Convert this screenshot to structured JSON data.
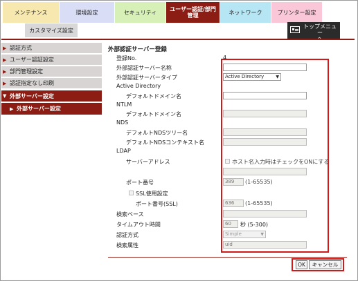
{
  "tabs": {
    "maintenance": "メンテナンス",
    "environment": "環境設定",
    "security": "セキュリティ",
    "user_auth_line1": "ユーザー認証/部門",
    "user_auth_line2": "管理",
    "network": "ネットワーク",
    "printer": "プリンター設定",
    "customize": "カスタマイズ設定"
  },
  "top_menu": {
    "line1": "トップメニュー",
    "line2": "へ",
    "icon": "menu-icon"
  },
  "sidebar": {
    "items": [
      {
        "label": "認証方式"
      },
      {
        "label": "ユーザー認証設定"
      },
      {
        "label": "部門管理設定"
      },
      {
        "label": "認証指定なし印刷"
      },
      {
        "label": "外部サーバー設定"
      },
      {
        "label": "外部サーバー設定"
      }
    ]
  },
  "form": {
    "title": "外部認証サーバー登録",
    "reg_no_label": "登録No.",
    "reg_no_value": "4",
    "server_name_label": "外部認証サーバー名称",
    "server_name_value": "",
    "server_type_label": "外部認証サーバータイプ",
    "server_type_value": "Active Directory",
    "ad_header": "Active Directory",
    "ad_domain_label": "デフォルトドメイン名",
    "ntlm_header": "NTLM",
    "ntlm_domain_label": "デフォルトドメイン名",
    "nds_header": "NDS",
    "nds_tree_label": "デフォルトNDSツリー名",
    "nds_context_label": "デフォルトNDSコンテキスト名",
    "ldap_header": "LDAP",
    "server_address_label": "サーバーアドレス",
    "host_check_label": "ホスト名入力時はチェックをONにする",
    "port_label": "ポート番号",
    "port_value": "389",
    "port_range": "(1-65535)",
    "ssl_label": "SSL使用設定",
    "ssl_port_label": "ポート番号(SSL)",
    "ssl_port_value": "636",
    "ssl_port_range": "(1-65535)",
    "search_base_label": "検索ベース",
    "timeout_label": "タイムアウト時間",
    "timeout_value": "60",
    "timeout_range": "秒 (5-300)",
    "auth_method_label": "認証方式",
    "auth_method_value": "Simple",
    "search_attr_label": "検索属性",
    "search_attr_value": "uid"
  },
  "buttons": {
    "ok": "OK",
    "cancel": "キャンセル"
  },
  "colors": {
    "accent": "#8b1d14",
    "highlight_border": "#d01a1a"
  }
}
